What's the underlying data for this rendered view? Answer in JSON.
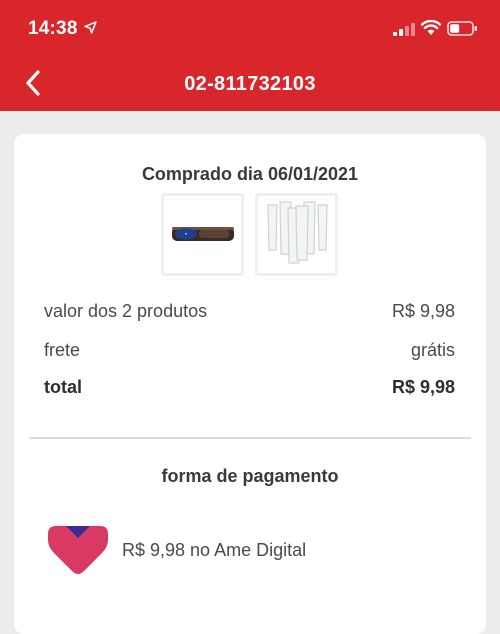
{
  "status_bar": {
    "time": "14:38"
  },
  "header": {
    "title": "02-811732103",
    "background": "#d8262b"
  },
  "order": {
    "purchase_date": "Comprado dia 06/01/2021",
    "product_images": [
      "product-cookie-package",
      "product-glass-set"
    ],
    "summary": [
      {
        "label": "valor dos 2 produtos",
        "value": "R$ 9,98"
      },
      {
        "label": "frete",
        "value": "grátis"
      },
      {
        "label": "total",
        "value": "R$ 9,98"
      }
    ]
  },
  "payment": {
    "title": "forma de pagamento",
    "method_text": "R$ 9,98 no Ame Digital",
    "method_icon": "ame-digital-logo"
  }
}
